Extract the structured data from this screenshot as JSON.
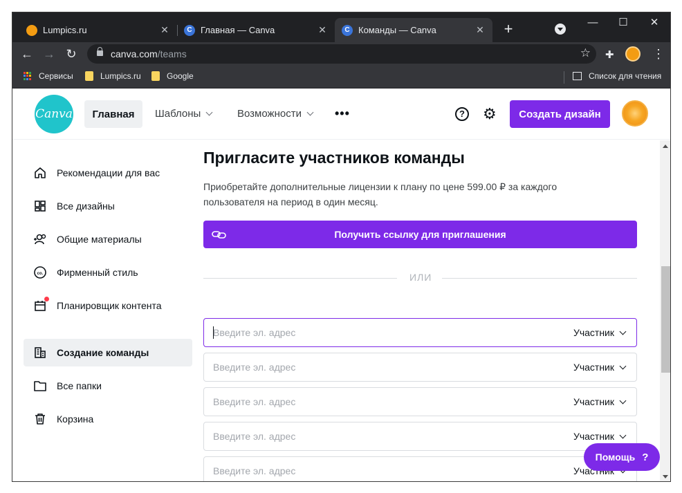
{
  "browser": {
    "tabs": [
      {
        "title": "Lumpics.ru",
        "active": false,
        "favicon": "orange-circle",
        "color": "#f39c12"
      },
      {
        "title": "Главная — Canva",
        "active": false,
        "favicon": "canva-icon",
        "color": "#3a74d9"
      },
      {
        "title": "Команды — Canva",
        "active": true,
        "favicon": "canva-icon",
        "color": "#3a74d9"
      }
    ],
    "newtab_label": "+",
    "url_host": "canva.com",
    "url_path": "/teams",
    "bookmarks": [
      {
        "label": "Сервисы",
        "icon": "apps-grid-icon"
      },
      {
        "label": "Lumpics.ru",
        "icon": "folder-icon"
      },
      {
        "label": "Google",
        "icon": "folder-icon"
      }
    ],
    "reading_list": "Список для чтения"
  },
  "header": {
    "logo_text": "Canva",
    "nav_home": "Главная",
    "nav_templates": "Шаблоны",
    "nav_features": "Возможности",
    "more": "•••",
    "help": "?",
    "create_button": "Создать дизайн"
  },
  "sidebar": {
    "items": [
      {
        "label": "Рекомендации для вас",
        "icon": "home-icon"
      },
      {
        "label": "Все дизайны",
        "icon": "grid-icon"
      },
      {
        "label": "Общие материалы",
        "icon": "people-icon"
      },
      {
        "label": "Фирменный стиль",
        "icon": "brand-icon"
      },
      {
        "label": "Планировщик контента",
        "icon": "calendar-icon"
      },
      {
        "label": "Создание команды",
        "icon": "building-icon",
        "active": true
      },
      {
        "label": "Все папки",
        "icon": "folder-icon"
      },
      {
        "label": "Корзина",
        "icon": "trash-icon"
      }
    ]
  },
  "main": {
    "heading": "Пригласите участников команды",
    "description": "Приобретайте дополнительные лицензии к плану по цене 599.00 ₽ за каждого пользователя на период в один месяц.",
    "invite_link_button": "Получить ссылку для приглашения",
    "or_text": "ИЛИ",
    "email_rows": [
      {
        "placeholder": "Введите эл. адрес",
        "role": "Участник"
      },
      {
        "placeholder": "Введите эл. адрес",
        "role": "Участник"
      },
      {
        "placeholder": "Введите эл. адрес",
        "role": "Участник"
      },
      {
        "placeholder": "Введите эл. адрес",
        "role": "Участник"
      },
      {
        "placeholder": "Введите эл. адрес",
        "role": "Участник"
      }
    ]
  },
  "help_pill": {
    "label": "Помощь",
    "icon": "?"
  },
  "colors": {
    "accent": "#7d2ae8",
    "logo": "#20c4cb",
    "chrome_dark": "#202124"
  }
}
